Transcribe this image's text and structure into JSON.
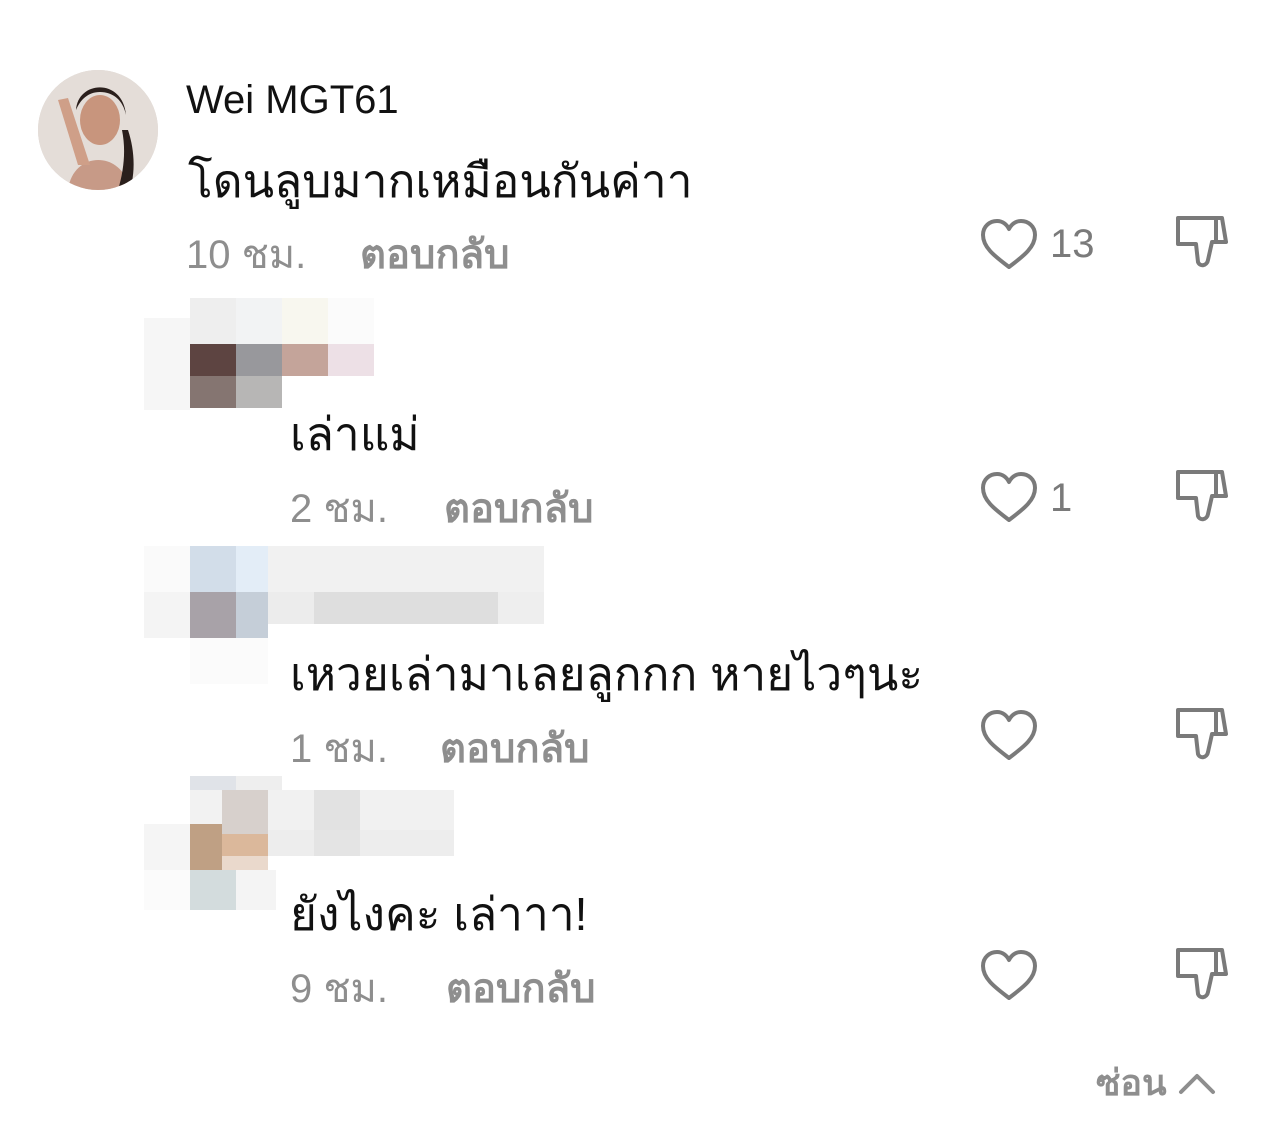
{
  "comment": {
    "username": "Wei MGT61",
    "text": "โดนลูบมากเหมือนกันค่าา",
    "time": "10 ชม.",
    "reply_label": "ตอบกลับ",
    "likes": "13"
  },
  "replies": [
    {
      "text": "เล่าแม่",
      "time": "2 ชม.",
      "reply_label": "ตอบกลับ",
      "likes": "1"
    },
    {
      "text": "เหวยเล่ามาเลยลูกกก หายไวๆนะ",
      "time": "1 ชม.",
      "reply_label": "ตอบกลับ",
      "likes": ""
    },
    {
      "text": "ยังไงคะ เล่าาา!",
      "time": "9 ชม.",
      "reply_label": "ตอบกลับ",
      "likes": ""
    }
  ],
  "footer": {
    "hide_label": "ซ่อน"
  },
  "icons": {
    "like": "heart-icon",
    "dislike": "thumbs-down-icon",
    "collapse": "chevron-up-icon"
  },
  "colors": {
    "text": "#111111",
    "muted": "#8e8e8e",
    "icon": "#7a7a7a"
  }
}
